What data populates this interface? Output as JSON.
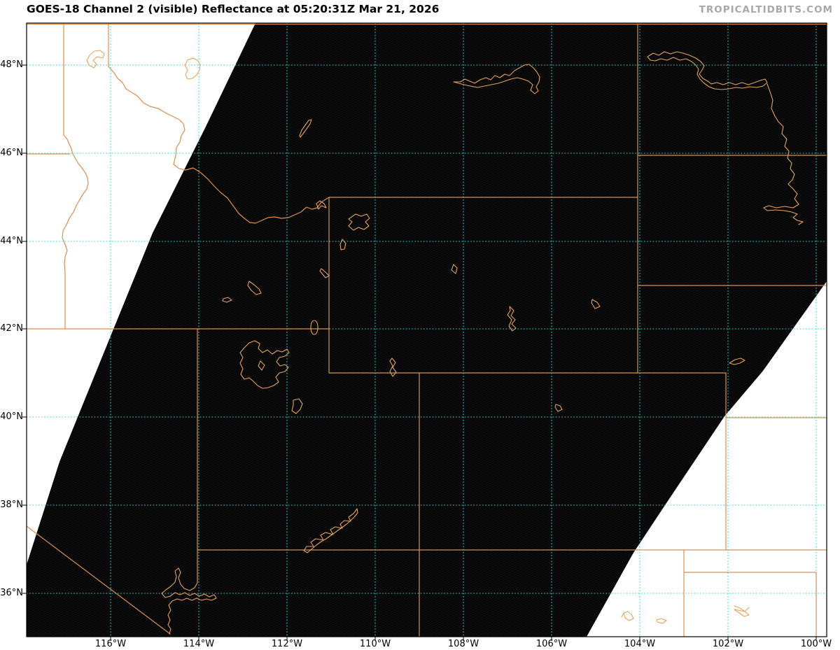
{
  "header": {
    "title": "GOES-18 Channel 2 (visible) Reflectance at 05:20:31Z Mar 21, 2026",
    "watermark": "TROPICALTIDBITS.COM"
  },
  "axes": {
    "lat_labels": [
      "48°N",
      "46°N",
      "44°N",
      "42°N",
      "40°N",
      "38°N",
      "36°N"
    ],
    "lon_labels": [
      "116°W",
      "114°W",
      "112°W",
      "110°W",
      "108°W",
      "106°W",
      "104°W",
      "102°W",
      "100°W"
    ]
  },
  "map": {
    "satellite": "GOES-18",
    "channel": "Channel 2 (visible)",
    "product": "Reflectance",
    "valid_time": "05:20:31Z Mar 21, 2026",
    "no_data_fill": "white",
    "data_fill": "near-black (nighttime visible imagery)"
  },
  "colors": {
    "border_orange": "#d9904f",
    "lake_orange": "#e2a35d",
    "grid_cyan": "#2fd6d6",
    "data_dark": "#060606",
    "no_data_white": "#ffffff",
    "watermark_gray": "#a8a8a8",
    "frame_black": "#000000"
  }
}
